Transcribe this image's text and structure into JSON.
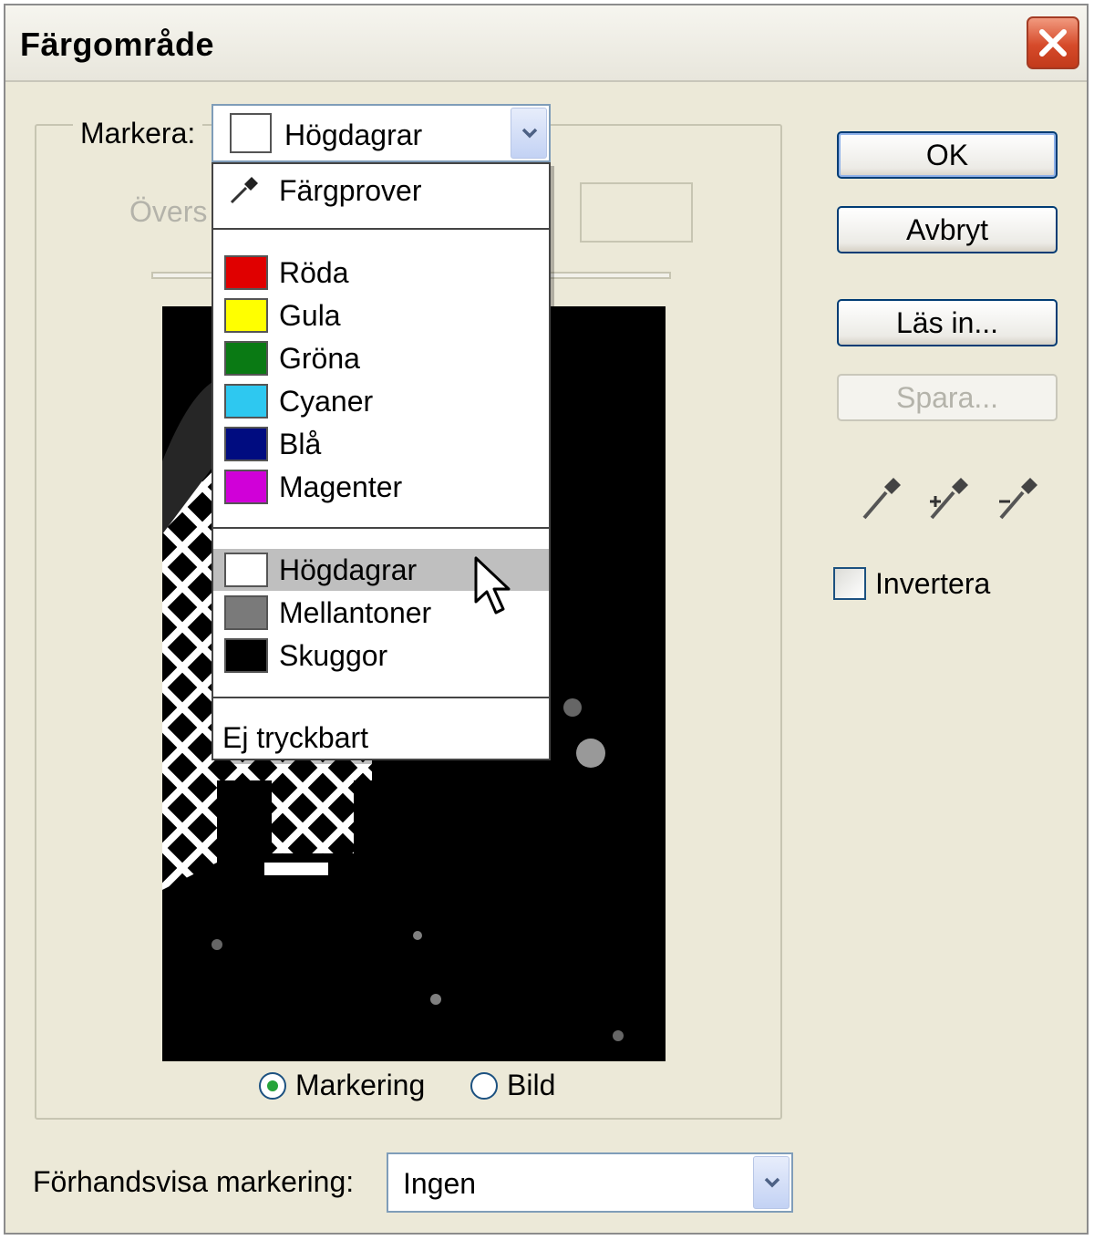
{
  "window": {
    "title": "Färgområde"
  },
  "select_group": {
    "label": "Markera:",
    "selected": "Högdagrar",
    "selected_color": "#ffffff",
    "fuzziness_label": "Övers"
  },
  "dropdown": {
    "sampled": "Färgprover",
    "colors": [
      {
        "label": "Röda",
        "color": "#e00000"
      },
      {
        "label": "Gula",
        "color": "#ffff00"
      },
      {
        "label": "Gröna",
        "color": "#0a7a14"
      },
      {
        "label": "Cyaner",
        "color": "#2ec8f0"
      },
      {
        "label": "Blå",
        "color": "#000c80"
      },
      {
        "label": "Magenter",
        "color": "#d000d8"
      }
    ],
    "tones": [
      {
        "label": "Högdagrar",
        "color": "#ffffff"
      },
      {
        "label": "Mellantoner",
        "color": "#7a7a7a"
      },
      {
        "label": "Skuggor",
        "color": "#000000"
      }
    ],
    "out_of_gamut": "Ej tryckbart"
  },
  "display_mode": {
    "selection_label": "Markering",
    "image_label": "Bild",
    "checked": "Markering"
  },
  "buttons": {
    "ok": "OK",
    "cancel": "Avbryt",
    "load": "Läs in...",
    "save": "Spara..."
  },
  "invert": {
    "label": "Invertera",
    "checked": false
  },
  "preview_selection": {
    "label": "Förhandsvisa markering:",
    "value": "Ingen"
  },
  "icons": [
    "close-icon",
    "eyedropper-icon",
    "eyedropper-plus-icon",
    "eyedropper-minus-icon",
    "dropdown-arrow-icon",
    "mouse-cursor-icon"
  ]
}
